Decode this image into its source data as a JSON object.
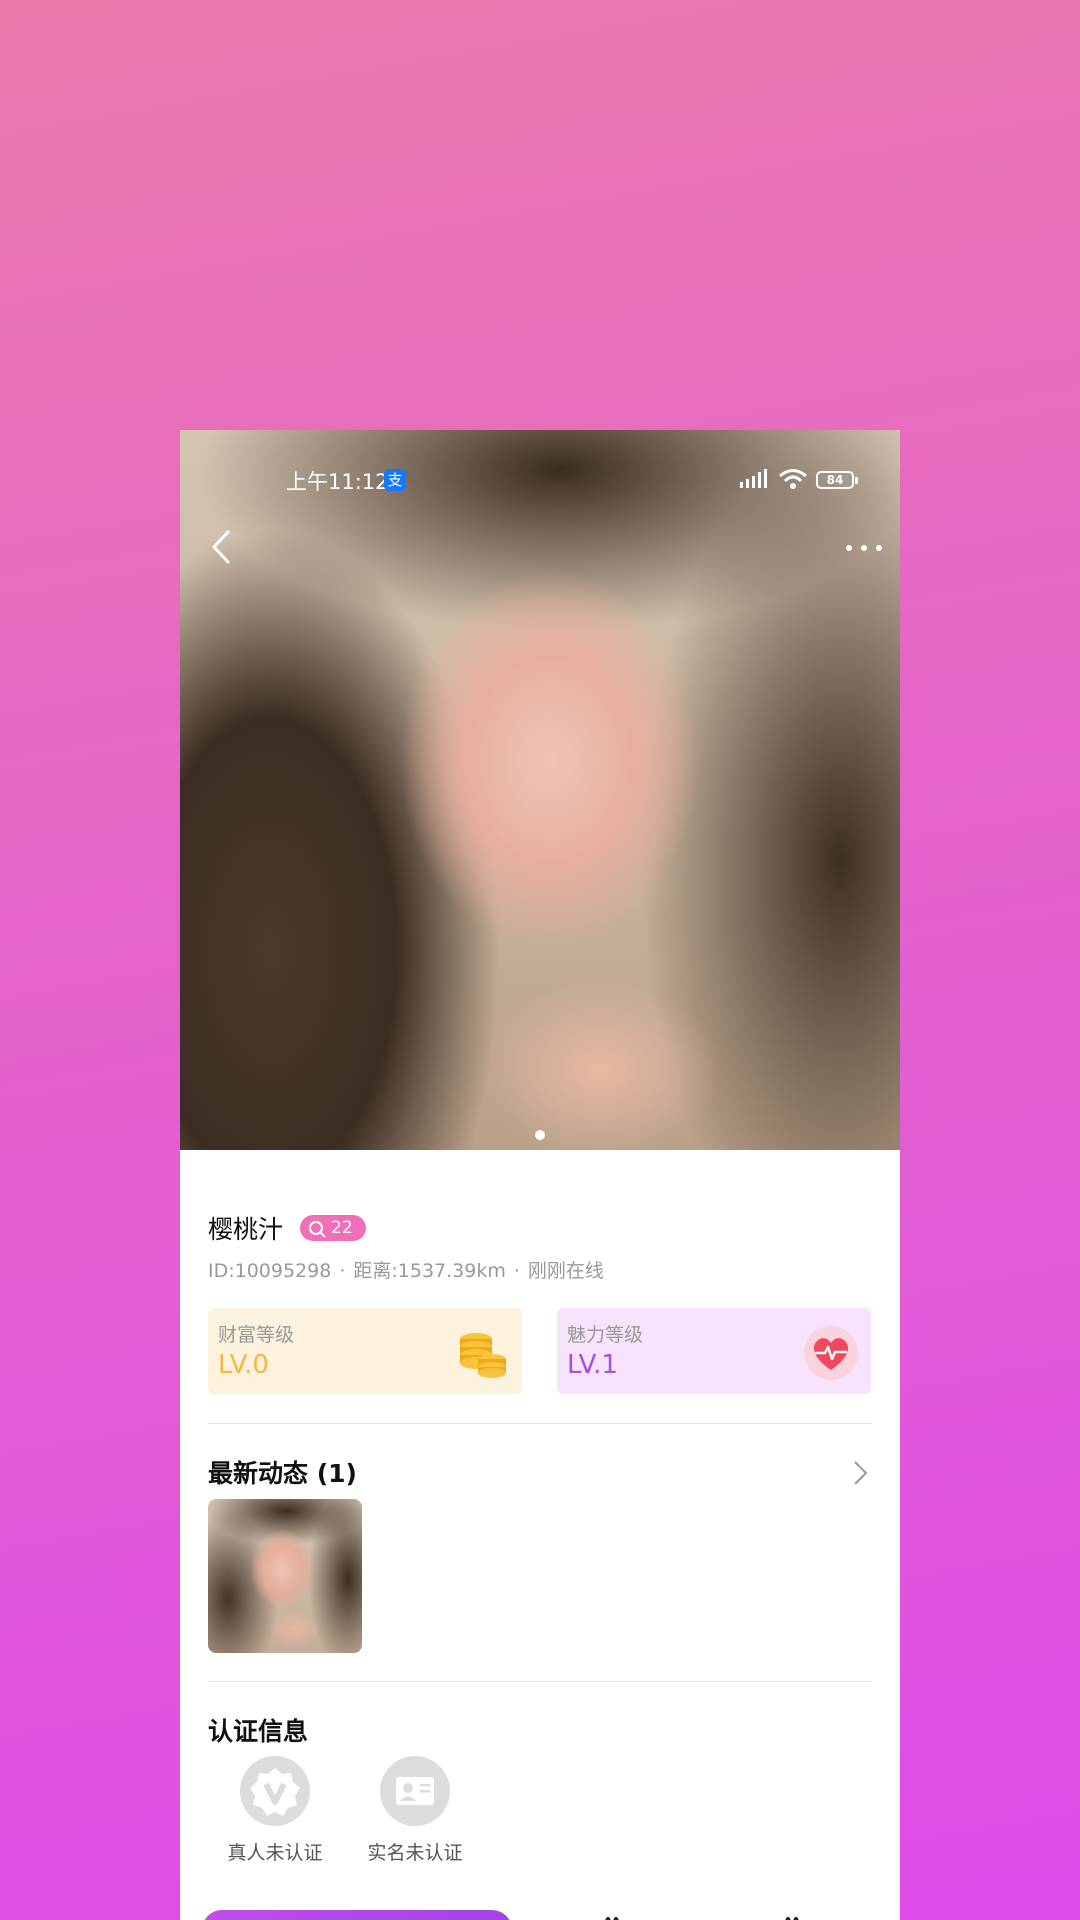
{
  "status_bar": {
    "time": "上午11:12",
    "app_badge": "支",
    "battery": "84"
  },
  "profile": {
    "name": "樱桃汁",
    "age": "22",
    "id": "ID:10095298",
    "distance": "距离:1537.39km",
    "online": "刚刚在线",
    "separator": "·"
  },
  "levels": {
    "wealth": {
      "title": "财富等级",
      "value": "LV.0"
    },
    "charm": {
      "title": "魅力等级",
      "value": "LV.1"
    }
  },
  "moments": {
    "title": "最新动态 (1)"
  },
  "certification": {
    "title": "认证信息",
    "items": [
      {
        "label": "真人未认证",
        "icon": "verified-v-icon"
      },
      {
        "label": "实名未认证",
        "icon": "id-card-icon"
      }
    ]
  },
  "colors": {
    "background_top": "#ea7aac",
    "background_bottom": "#df4bea",
    "age_badge": "#f06fb7",
    "wealth_accent": "#f3b746",
    "charm_accent": "#a54ee0"
  }
}
